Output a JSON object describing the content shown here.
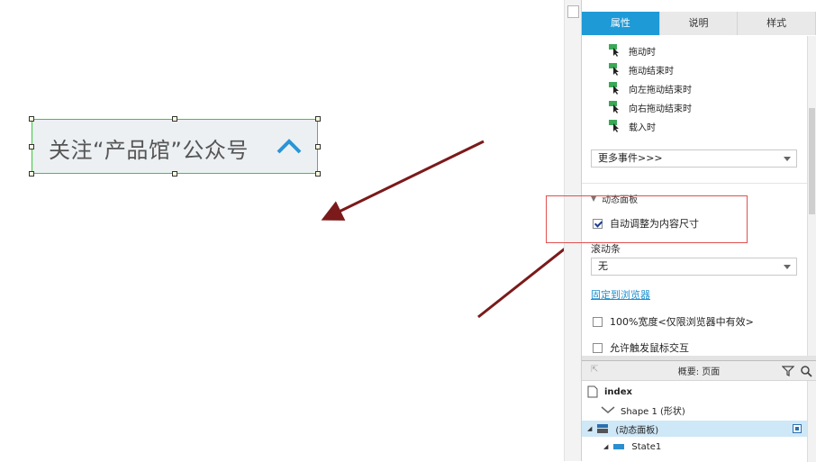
{
  "canvas": {
    "widget_label": "关注“产品馆”公众号",
    "widget_border_color": "#3cc83c",
    "arrow_color": "#7b1a1a"
  },
  "inspector": {
    "tabs": [
      {
        "label": "属性",
        "active": true
      },
      {
        "label": "说明",
        "active": false
      },
      {
        "label": "样式",
        "active": false
      }
    ],
    "events": [
      "拖动时",
      "拖动结束时",
      "向左拖动结束时",
      "向右拖动结束时",
      "载入时"
    ],
    "more_events": "更多事件>>>",
    "section_title": "动态面板",
    "auto_fit": {
      "label": "自动调整为内容尺寸",
      "checked": true
    },
    "scrollbar_label": "滚动条",
    "scrollbar_value": "无",
    "pin_link": "固定到浏览器",
    "width_100": {
      "label": "100%宽度<仅限浏览器中有效>",
      "checked": false
    },
    "mouse_interact": {
      "label": "允许触发鼠标交互",
      "checked": false
    },
    "accent_color": "#1e9ad6",
    "highlight_color": "#e05050"
  },
  "outline": {
    "title": "概要: 页面",
    "tree": [
      {
        "label": "index",
        "icon": "page-icon"
      },
      {
        "label": "Shape 1 (形状)",
        "icon": "chevron-down-icon"
      },
      {
        "label": "(动态面板)",
        "icon": "panel-icon",
        "selected": true
      },
      {
        "label": "State1",
        "icon": "state-icon"
      }
    ]
  }
}
